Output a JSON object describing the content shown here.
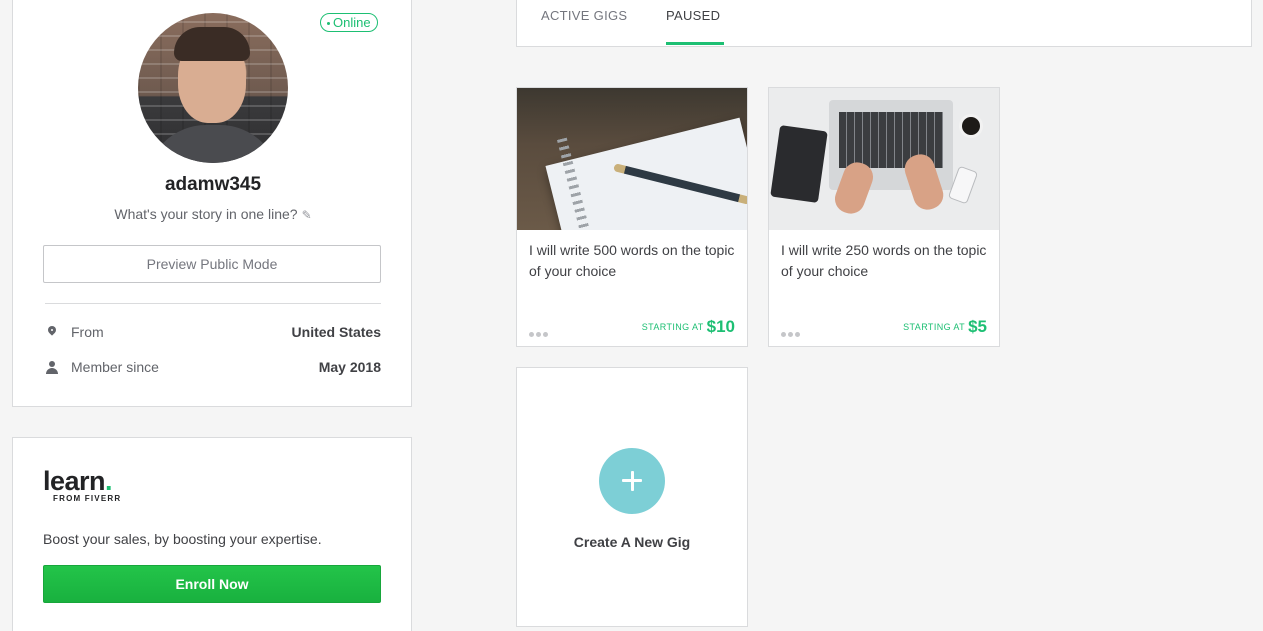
{
  "profile": {
    "online_status": "Online",
    "username": "adamw345",
    "tagline": "What's your story in one line?",
    "preview_button": "Preview Public Mode",
    "from_label": "From",
    "from_value": "United States",
    "member_label": "Member since",
    "member_value": "May 2018"
  },
  "learn": {
    "logo_word": "learn",
    "logo_dot": ".",
    "logo_sub": "FROM FIVERR",
    "text": "Boost your sales, by boosting your expertise.",
    "button": "Enroll Now"
  },
  "tabs": {
    "active_gigs": "ACTIVE GIGS",
    "paused": "PAUSED",
    "selected": "PAUSED"
  },
  "gigs": [
    {
      "title": "I will write 500 words on the topic of your choice",
      "starting_label": "STARTING AT",
      "price": "$10"
    },
    {
      "title": "I will write 250 words on the topic of your choice",
      "starting_label": "STARTING AT",
      "price": "$5"
    }
  ],
  "create_gig": {
    "label": "Create A New Gig"
  },
  "colors": {
    "accent_green": "#1dbf73",
    "button_green": "#1dbf3a",
    "plus_circle": "#7dcfd6"
  }
}
